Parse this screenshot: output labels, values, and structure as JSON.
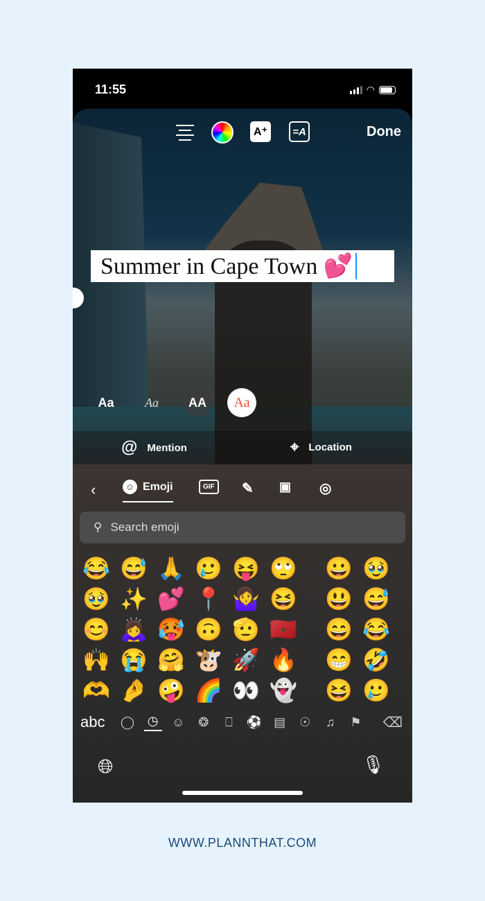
{
  "status": {
    "time": "11:55"
  },
  "toolbar": {
    "done_label": "Done",
    "effect_glyph": "A⁺",
    "animate_glyph": "=A"
  },
  "caption": {
    "text": "Summer in Cape Town 💕"
  },
  "fonts": [
    "Aa",
    "Aa",
    "AA",
    "Aa"
  ],
  "actions": {
    "mention": "Mention",
    "location": "Location"
  },
  "keyboard": {
    "tabs": {
      "back": "‹",
      "emoji": "Emoji",
      "gif": "GIF"
    },
    "search_placeholder": "Search emoji",
    "emoji_rows": [
      [
        "😂",
        "😅",
        "🙏",
        "🥲",
        "😝",
        "🙄",
        "😀",
        "🥹"
      ],
      [
        "🥹",
        "✨",
        "💕",
        "📍",
        "🤷‍♀️",
        "😆",
        "😃",
        "😅"
      ],
      [
        "😊",
        "🙇‍♀️",
        "🥵",
        "🙃",
        "🫡",
        "🇲🇦",
        "😄",
        "😂"
      ],
      [
        "🙌",
        "😭",
        "🤗",
        "🐮",
        "🚀",
        "🔥",
        "😁",
        "🤣"
      ],
      [
        "🫶",
        "🤌",
        "🤪",
        "🌈",
        "👀",
        "👻",
        "😆",
        "🥲"
      ]
    ],
    "abc_label": "abc",
    "categories": [
      "memoji-icon",
      "clock-icon",
      "smiley-icon",
      "animal-icon",
      "food-icon",
      "ball-icon",
      "travel-icon",
      "bulb-icon",
      "symbols-icon",
      "flag-icon"
    ],
    "category_glyphs": [
      "◯",
      "◷",
      "☺",
      "❂",
      "⎕",
      "⚽",
      "▤",
      "☉",
      "♫",
      "⚑"
    ],
    "active_category": "clock-icon"
  },
  "footer": {
    "url": "WWW.PLANNTHAT.COM"
  }
}
